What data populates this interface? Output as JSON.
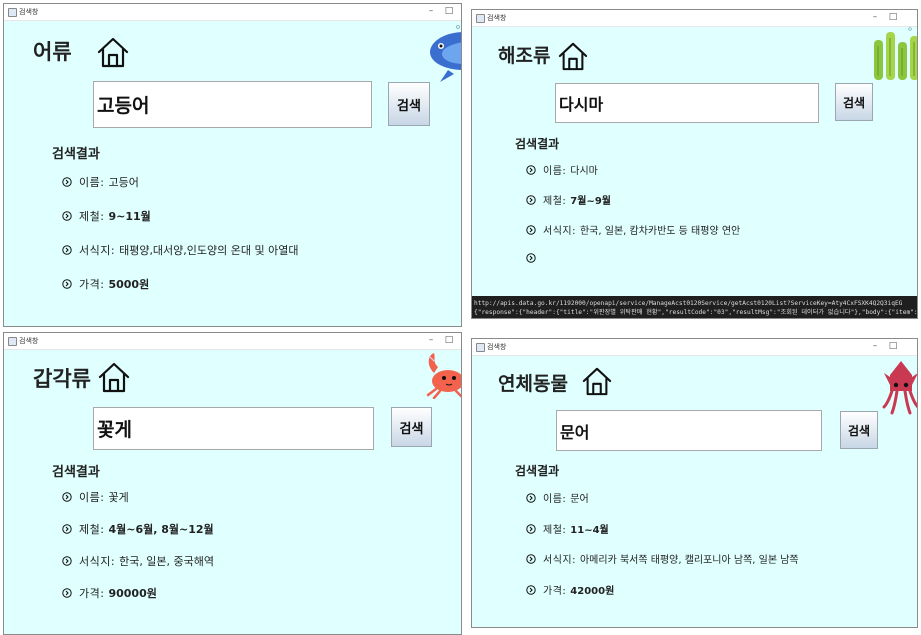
{
  "window_title": "검색창",
  "panels": [
    {
      "category": "어류",
      "search_value": "고등어",
      "search_button": "검색",
      "result_header": "검색결과",
      "rows": [
        {
          "label": "이름:",
          "value": "고등어",
          "bold": false
        },
        {
          "label": "제철:",
          "value": "9~11월",
          "bold": true
        },
        {
          "label": "서식지:",
          "value": "태평양,대서양,인도양의 온대 및 아열대",
          "bold": false
        },
        {
          "label": "가격:",
          "value": "5000원",
          "bold": true
        }
      ],
      "illustration": "fish-icon"
    },
    {
      "category": "해조류",
      "search_value": "다시마",
      "search_button": "검색",
      "result_header": "검색결과",
      "rows": [
        {
          "label": "이름:",
          "value": "다시마",
          "bold": false
        },
        {
          "label": "제철:",
          "value": "7월~9월",
          "bold": true
        },
        {
          "label": "서식지:",
          "value": "한국, 일본, 캄차카반도 등 태평양 연안",
          "bold": false
        },
        {
          "label": "",
          "value": "",
          "bold": false
        }
      ],
      "illustration": "seaweed-icon",
      "console": {
        "line1": "http://apis.data.go.kr/1192000/openapi/service/ManageAcst0120Service/getAcst0120List?ServiceKey=Aty4CxFSXK4Q2Q3iqEG",
        "line2": "{\"response\":{\"header\":{\"title\":\"위판장별 위탁판매 현황\",\"resultCode\":\"03\",\"resultMsg\":\"조회된 데이터가 없습니다\"},\"body\":{\"item\":[]"
      }
    },
    {
      "category": "갑각류",
      "search_value": "꽃게",
      "search_button": "검색",
      "result_header": "검색결과",
      "rows": [
        {
          "label": "이름:",
          "value": "꽃게",
          "bold": false
        },
        {
          "label": "제철:",
          "value": "4월~6월, 8월~12월",
          "bold": true
        },
        {
          "label": "서식지:",
          "value": "한국, 일본, 중국해역",
          "bold": false
        },
        {
          "label": "가격:",
          "value": "90000원",
          "bold": true
        }
      ],
      "illustration": "crab-icon"
    },
    {
      "category": "연체동물",
      "search_value": "문어",
      "search_button": "검색",
      "result_header": "검색결과",
      "rows": [
        {
          "label": "이름:",
          "value": "문어",
          "bold": false
        },
        {
          "label": "제철:",
          "value": "11~4월",
          "bold": true
        },
        {
          "label": "서식지:",
          "value": "아메리카 북서쪽 태평양, 캘리포니아 남쪽, 일본 남쪽",
          "bold": false
        },
        {
          "label": "가격:",
          "value": "42000원",
          "bold": true
        }
      ],
      "illustration": "squid-icon"
    }
  ]
}
